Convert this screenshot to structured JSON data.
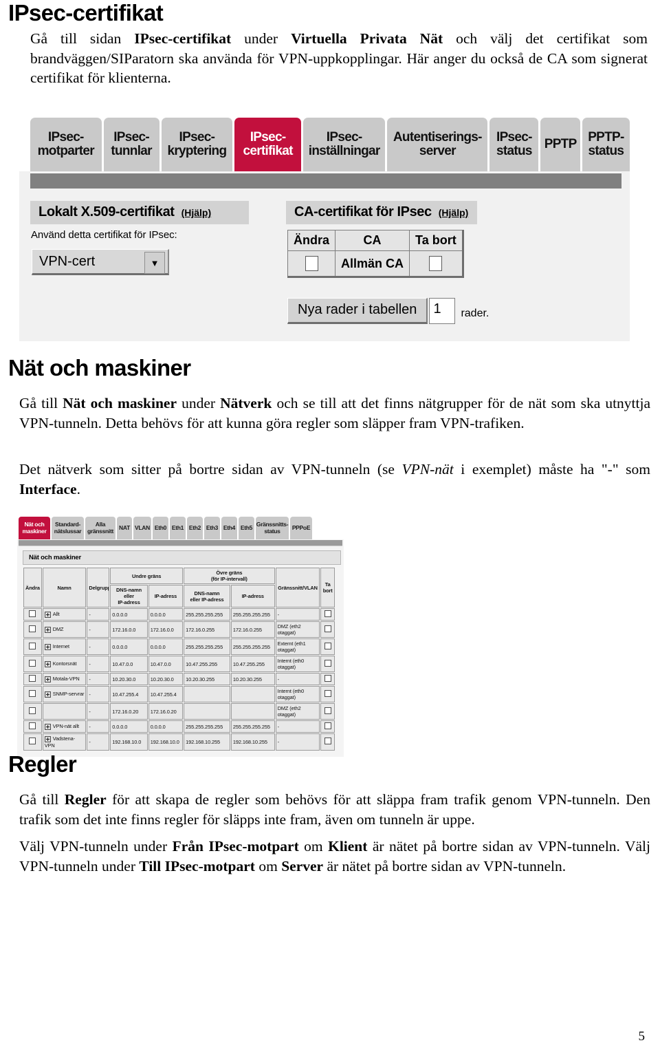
{
  "document": {
    "page_number": "5"
  },
  "section1": {
    "heading": "IPsec-certifikat",
    "paragraph_parts": [
      {
        "t": "Gå till sidan ",
        "s": "n"
      },
      {
        "t": "IPsec-certifikat",
        "s": "b"
      },
      {
        "t": " under ",
        "s": "n"
      },
      {
        "t": "Virtuella Privata Nät",
        "s": "b"
      },
      {
        "t": " och välj det certifikat som brandväggen/SIParatorn ska använda för VPN-uppkopplingar. Här anger du också de CA som signerat certifikat för klienterna.",
        "s": "n"
      }
    ]
  },
  "screenshot1": {
    "tabs": [
      {
        "label": "IPsec-\nmotparter",
        "active": false
      },
      {
        "label": "IPsec-\ntunnlar",
        "active": false
      },
      {
        "label": "IPsec-\nkryptering",
        "active": false
      },
      {
        "label": "IPsec-\ncertifikat",
        "active": true
      },
      {
        "label": "IPsec-\ninställningar",
        "active": false
      },
      {
        "label": "Autentiserings-\nserver",
        "active": false
      },
      {
        "label": "IPsec-\nstatus",
        "active": false
      },
      {
        "label": "PPTP",
        "active": false
      },
      {
        "label": "PPTP-\nstatus",
        "active": false
      }
    ],
    "left_panel": {
      "title": "Lokalt X.509-certifikat",
      "help": "(Hjälp)",
      "field_label": "Använd detta certifikat för IPsec:",
      "select_value": "VPN-cert",
      "select_arrow": "▼"
    },
    "right_panel": {
      "title": "CA-certifikat för IPsec",
      "help": "(Hjälp)",
      "table_headers": [
        "Ändra",
        "CA",
        "Ta bort"
      ],
      "rows": [
        {
          "andra_checked": false,
          "ca": "Allmän CA",
          "tabort_checked": false
        }
      ],
      "add_rows_button": "Nya rader i tabellen",
      "add_rows_value": "1",
      "add_rows_suffix": "rader."
    }
  },
  "section2": {
    "heading": "Nät och maskiner",
    "paragraph1_parts": [
      {
        "t": "Gå till ",
        "s": "n"
      },
      {
        "t": "Nät och maskiner",
        "s": "b"
      },
      {
        "t": " under ",
        "s": "n"
      },
      {
        "t": "Nätverk",
        "s": "b"
      },
      {
        "t": " och se till att det finns nätgrupper för de nät som ska utnyttja VPN-tunneln. Detta behövs för att kunna göra regler som släpper fram VPN-trafiken.",
        "s": "n"
      }
    ],
    "paragraph2_parts": [
      {
        "t": "Det nätverk som sitter på bortre sidan av VPN-tunneln (se ",
        "s": "n"
      },
      {
        "t": "VPN-nät",
        "s": "i"
      },
      {
        "t": " i exemplet) måste ha \"-\" som ",
        "s": "n"
      },
      {
        "t": "Interface",
        "s": "b"
      },
      {
        "t": ".",
        "s": "n"
      }
    ]
  },
  "screenshot2": {
    "tabs": [
      {
        "label": "Nät och\nmaskiner",
        "active": true
      },
      {
        "label": "Standard-\nnätslussar",
        "active": false
      },
      {
        "label": "Alla\ngränssnitt",
        "active": false
      },
      {
        "label": "NAT",
        "active": false
      },
      {
        "label": "VLAN",
        "active": false
      },
      {
        "label": "Eth0",
        "active": false
      },
      {
        "label": "Eth1",
        "active": false
      },
      {
        "label": "Eth2",
        "active": false
      },
      {
        "label": "Eth3",
        "active": false
      },
      {
        "label": "Eth4",
        "active": false
      },
      {
        "label": "Eth5",
        "active": false
      },
      {
        "label": "Gränssnitts-\nstatus",
        "active": false
      },
      {
        "label": "PPPoE",
        "active": false
      }
    ],
    "caption": "Nät och maskiner",
    "group_headers": {
      "undre": "Undre gräns",
      "ovre": "Övre gräns",
      "ovre_sub": "(för IP-intervall)"
    },
    "headers": {
      "andra": "Ändra",
      "namn": "Namn",
      "delgrupp": "Delgrupp",
      "undre_dns": "DNS-namn\neller\nIP-adress",
      "undre_ip": "IP-adress",
      "ovre_dns": "DNS-namn\neller IP-adress",
      "ovre_ip": "IP-adress",
      "gransnitt": "Gränssnitt/VLAN",
      "tabort": "Ta\nbort"
    },
    "rows": [
      {
        "namn": "Allt",
        "has_plus": true,
        "delgrupp": "-",
        "undre_dns": "0.0.0.0",
        "undre_ip": "0.0.0.0",
        "ovre_dns": "255.255.255.255",
        "ovre_ip": "255.255.255.255",
        "gransnitt": "-"
      },
      {
        "namn": "DMZ",
        "has_plus": true,
        "delgrupp": "-",
        "undre_dns": "172.16.0.0",
        "undre_ip": "172.16.0.0",
        "ovre_dns": "172.16.0.255",
        "ovre_ip": "172.16.0.255",
        "gransnitt": "DMZ (eth2 otaggat)"
      },
      {
        "namn": "Internet",
        "has_plus": true,
        "delgrupp": "-",
        "undre_dns": "0.0.0.0",
        "undre_ip": "0.0.0.0",
        "ovre_dns": "255.255.255.255",
        "ovre_ip": "255.255.255.255",
        "gransnitt": "Externt (eth1 otaggat)"
      },
      {
        "namn": "Kontorsnät",
        "has_plus": true,
        "delgrupp": "-",
        "undre_dns": "10.47.0.0",
        "undre_ip": "10.47.0.0",
        "ovre_dns": "10.47.255.255",
        "ovre_ip": "10.47.255.255",
        "gransnitt": "Internt (eth0 otaggat)"
      },
      {
        "namn": "Motala-VPN",
        "has_plus": true,
        "delgrupp": "-",
        "undre_dns": "10.20.30.0",
        "undre_ip": "10.20.30.0",
        "ovre_dns": "10.20.30.255",
        "ovre_ip": "10.20.30.255",
        "gransnitt": "-"
      },
      {
        "namn": "SNMP-servrar",
        "has_plus": true,
        "delgrupp": "-",
        "undre_dns": "10.47.255.4",
        "undre_ip": "10.47.255.4",
        "ovre_dns": "",
        "ovre_ip": "",
        "gransnitt": "Internt (eth0 otaggat)"
      },
      {
        "namn": "",
        "has_plus": false,
        "delgrupp": "-",
        "undre_dns": "172.16.0.20",
        "undre_ip": "172.16.0.20",
        "ovre_dns": "",
        "ovre_ip": "",
        "gransnitt": "DMZ (eth2 otaggat)"
      },
      {
        "namn": "VPN-nät allt",
        "has_plus": true,
        "delgrupp": "-",
        "undre_dns": "0.0.0.0",
        "undre_ip": "0.0.0.0",
        "ovre_dns": "255.255.255.255",
        "ovre_ip": "255.255.255.255",
        "gransnitt": "-"
      },
      {
        "namn": "Vadstena-VPN",
        "has_plus": true,
        "delgrupp": "-",
        "undre_dns": "192.168.10.0",
        "undre_ip": "192.168.10.0",
        "ovre_dns": "192.168.10.255",
        "ovre_ip": "192.168.10.255",
        "gransnitt": "-"
      }
    ]
  },
  "section3": {
    "heading": "Regler",
    "paragraph1_parts": [
      {
        "t": "Gå till ",
        "s": "n"
      },
      {
        "t": "Regler",
        "s": "b"
      },
      {
        "t": " för att skapa de regler som behövs för att släppa fram trafik genom VPN-tunneln. Den trafik som det inte finns regler för släpps inte fram, även om tunneln är uppe.",
        "s": "n"
      }
    ],
    "paragraph2_parts": [
      {
        "t": "Välj VPN-tunneln under ",
        "s": "n"
      },
      {
        "t": "Från IPsec-motpart",
        "s": "b"
      },
      {
        "t": " om ",
        "s": "n"
      },
      {
        "t": "Klient",
        "s": "b"
      },
      {
        "t": " är nätet på bortre sidan av VPN-tunneln. Välj VPN-tunneln under ",
        "s": "n"
      },
      {
        "t": "Till IPsec-motpart",
        "s": "b"
      },
      {
        "t": " om ",
        "s": "n"
      },
      {
        "t": "Server",
        "s": "b"
      },
      {
        "t": " är nätet på bortre sidan av VPN-tunneln.",
        "s": "n"
      }
    ]
  },
  "colors": {
    "accent": "#c2103d",
    "tab_gray": "#c9c9c9",
    "strip_gray": "#808080"
  }
}
